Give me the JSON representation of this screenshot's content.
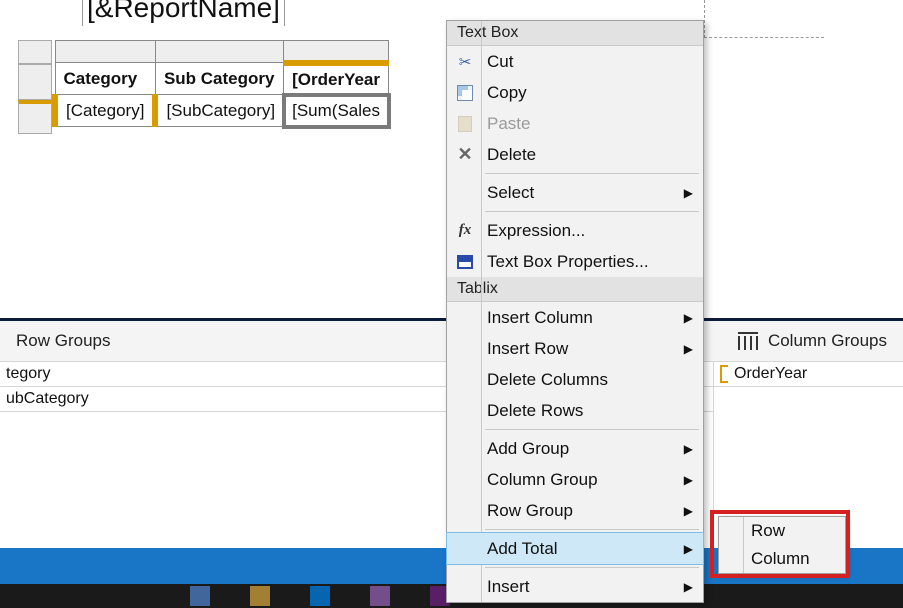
{
  "report_title": "[&ReportName]",
  "tablix": {
    "headers": [
      "Category",
      "Sub Category",
      "[OrderYear"
    ],
    "row": [
      "[Category]",
      "[SubCategory]",
      "[Sum(Sales"
    ]
  },
  "groups_panel": {
    "row_groups_label": "Row Groups",
    "column_groups_label": "Column Groups",
    "row_groups": [
      "tegory",
      "ubCategory"
    ],
    "col_groups": [
      "OrderYear"
    ]
  },
  "context_menu": {
    "section1": "Text Box",
    "cut": "Cut",
    "copy": "Copy",
    "paste": "Paste",
    "delete": "Delete",
    "select": "Select",
    "expression": "Expression...",
    "textbox_props": "Text Box Properties...",
    "section2": "Tablix",
    "insert_column": "Insert Column",
    "insert_row": "Insert Row",
    "delete_columns": "Delete Columns",
    "delete_rows": "Delete Rows",
    "add_group": "Add Group",
    "column_group": "Column Group",
    "row_group": "Row Group",
    "add_total": "Add Total",
    "insert": "Insert"
  },
  "submenu": {
    "row": "Row",
    "column": "Column"
  }
}
